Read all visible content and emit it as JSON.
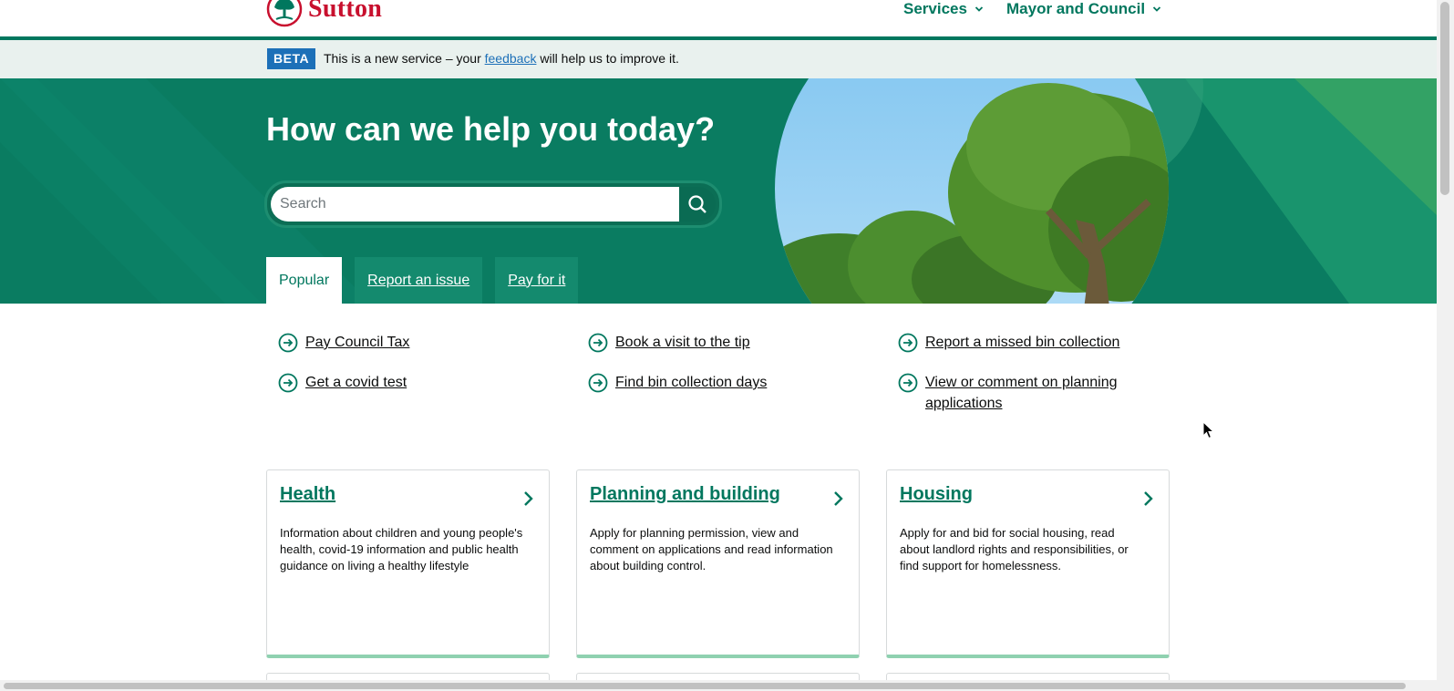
{
  "header": {
    "logo_text": "Sutton",
    "nav": [
      {
        "label": "Services"
      },
      {
        "label": "Mayor and Council"
      }
    ]
  },
  "beta": {
    "tag": "BETA",
    "text_before": "This is a new service – your",
    "link": "feedback",
    "text_after": "will help us to improve it."
  },
  "hero": {
    "title": "How can we help you today?",
    "search_placeholder": "Search",
    "tabs": [
      {
        "label": "Popular",
        "active": true
      },
      {
        "label": "Report an issue",
        "active": false
      },
      {
        "label": "Pay for it",
        "active": false
      }
    ]
  },
  "quick_links": [
    "Pay Council Tax",
    "Book a visit to the tip",
    "Report a missed bin collection",
    "Get a covid test",
    "Find bin collection days",
    "View or comment on planning applications"
  ],
  "cards": [
    {
      "title": "Health",
      "description": "Information about children and young people's health, covid-19 information and public health guidance on living a healthy lifestyle"
    },
    {
      "title": "Planning and building",
      "description": "Apply for planning permission, view and comment on applications and read information about building control."
    },
    {
      "title": "Housing",
      "description": "Apply for and bid for social housing, read about landlord rights and responsibilities, or find support for homelessness."
    }
  ],
  "colors": {
    "brand_green": "#00775e",
    "hero_green": "#0a7c61",
    "logo_red": "#c8102e",
    "beta_blue": "#1d70b8"
  }
}
